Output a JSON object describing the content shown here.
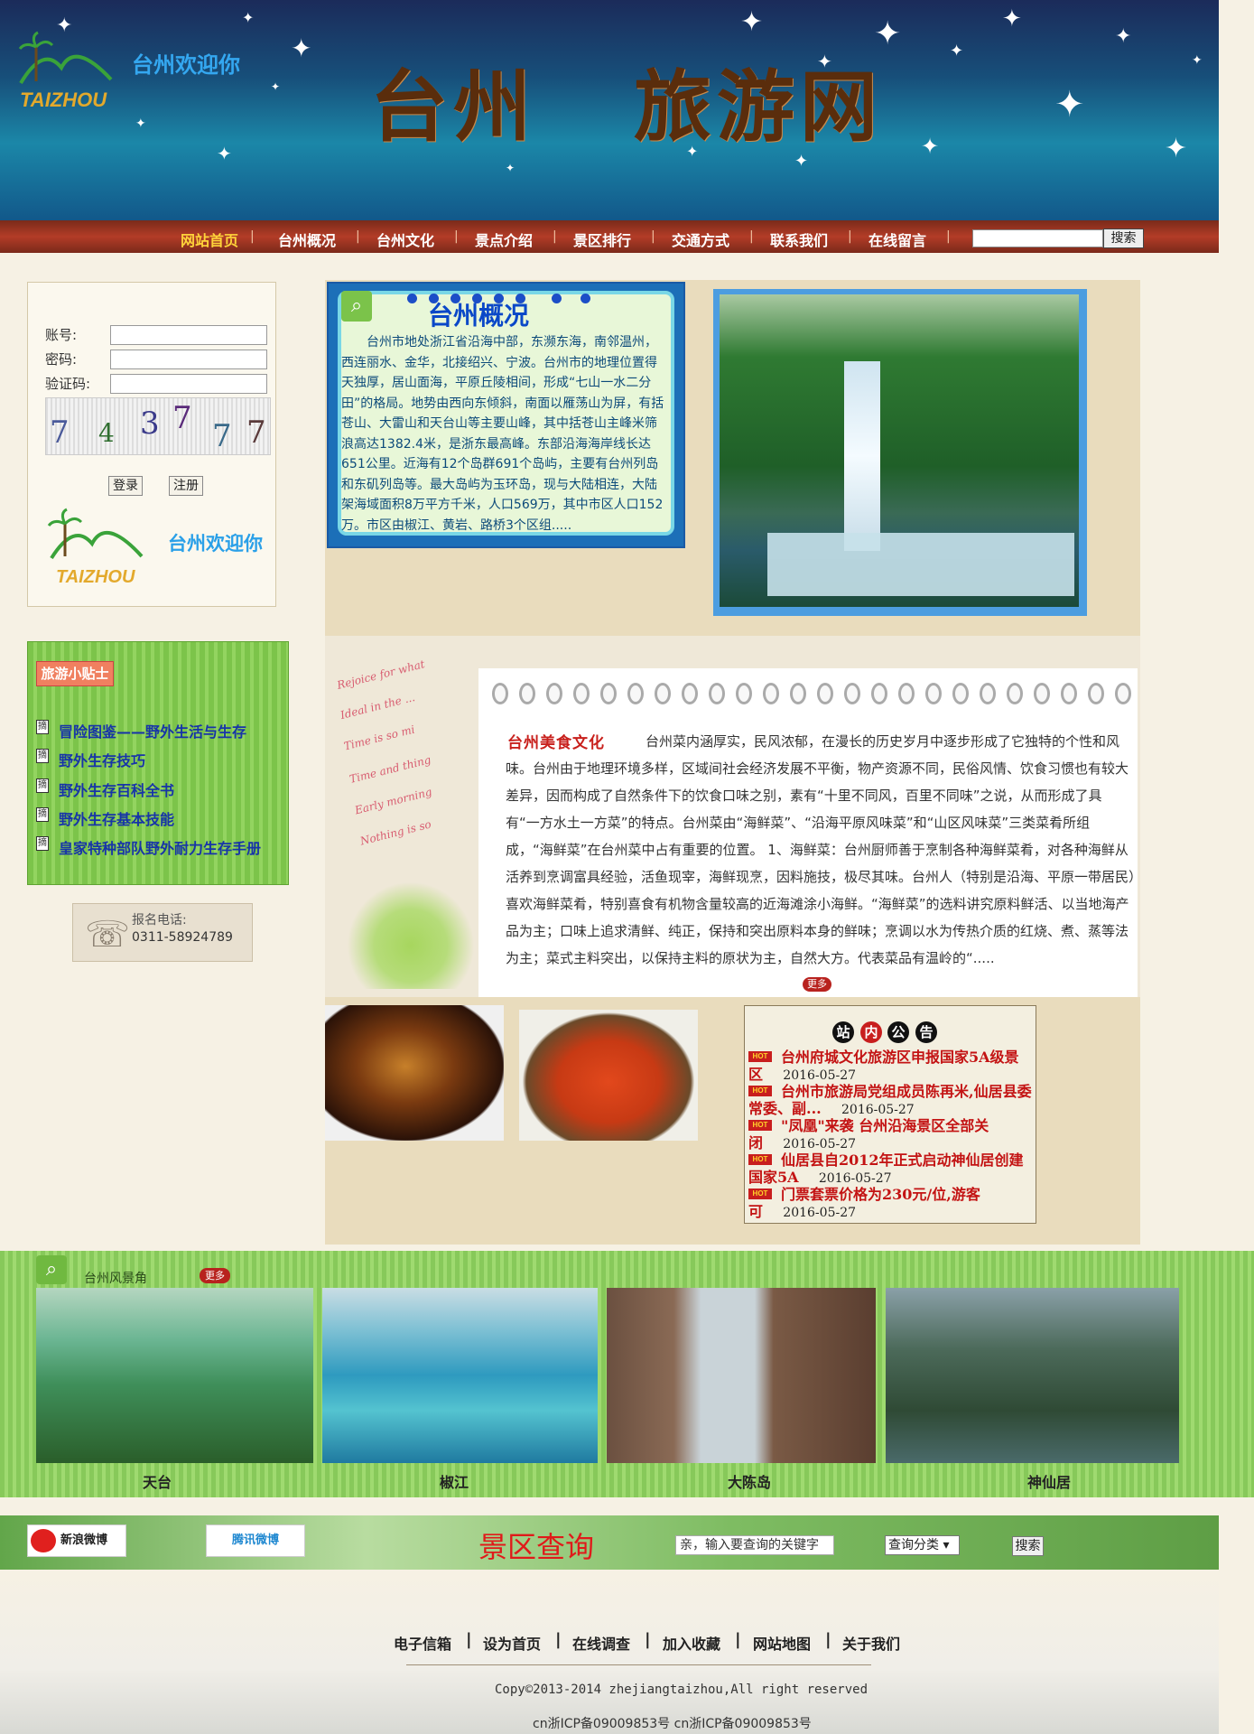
{
  "header": {
    "logo_text": "TAIZHOU",
    "welcome": "台州欢迎你",
    "site_title": "台州   旅游网"
  },
  "nav": {
    "items": [
      "网站首页",
      "台州概况",
      "台州文化",
      "景点介绍",
      "景区排行",
      "交通方式",
      "联系我们",
      "在线留言"
    ],
    "active_color": "#ffd43a",
    "search_button": "搜索"
  },
  "login": {
    "account_label": "账号:",
    "password_label": "密码:",
    "captcha_label": "验证码:",
    "captcha_chars": [
      "7",
      "4",
      "3",
      "7",
      "7",
      "7"
    ],
    "login_button": "登录",
    "register_button": "注册",
    "welcome": "台州欢迎你",
    "logo_text": "TAIZHOU"
  },
  "tips": {
    "title": "旅游小贴士",
    "icon_text": "摘",
    "items": [
      "冒险图鉴——野外生活与生存",
      "野外生存技巧",
      "野外生存百科全书",
      "野外生存基本技能",
      "皇家特种部队野外耐力生存手册"
    ]
  },
  "contact": {
    "label": "报名电话:",
    "phone": "0311-58924789"
  },
  "overview": {
    "title": "台州概况",
    "text": "台州市地处浙江省沿海中部，东濒东海，南邻温州，西连丽水、金华，北接绍兴、宁波。台州市的地理位置得天独厚，居山面海，平原丘陵相间，形成“七山一水二分田”的格局。地势由西向东倾斜，南面以雁荡山为屏，有括苍山、大雷山和天台山等主要山峰，其中括苍山主峰米筛浪高达1382.4米，是浙东最高峰。东部沿海海岸线长达651公里。近海有12个岛群691个岛屿，主要有台州列岛和东矶列岛等。最大岛屿为玉环岛，现与大陆相连，大陆架海域面积8万平方千米，人口569万，其中市区人口152万。市区由椒江、黄岩、路桥3个区组....."
  },
  "food": {
    "heading": "台州美食文化",
    "text": "台州菜内涵厚实，民风浓郁，在漫长的历史岁月中逐步形成了它独特的个性和风味。台州由于地理环境多样，区域间社会经济发展不平衡，物产资源不同，民俗风情、饮食习惯也有较大差异，因而构成了自然条件下的饮食口味之别，素有“十里不同风，百里不同味”之说，从而形成了具有“一方水土一方菜”的特点。台州菜由“海鲜菜”、“沿海平原风味菜”和“山区风味菜”三类菜肴所组成，“海鲜菜”在台州菜中占有重要的位置。 1、海鲜菜：台州厨师善于烹制各种海鲜菜肴，对各种海鲜从活养到烹调富具经验，活鱼现宰，海鲜现烹，因料施技，极尽其味。台州人（特别是沿海、平原一带居民）喜欢海鲜菜肴，特别喜食有机物含量较高的近海滩涂小海鲜。“海鲜菜”的选料讲究原料鲜活、以当地海产品为主；口味上追求清鲜、纯正，保持和突出原料本身的鲜味；烹调以水为传热介质的红烧、煮、蒸等法为主；菜式主料突出，以保持主料的原状为主，自然大方。代表菜品有温岭的“.....",
    "more": "更多",
    "script_lines": [
      "Rejoice for what",
      "Ideal in the ...",
      "Time is so mi",
      "Time and thing",
      "Early morning",
      "Nothing is so"
    ]
  },
  "notices": {
    "heading": [
      "站",
      "内",
      "公",
      "告"
    ],
    "hot_label": "HOT",
    "items": [
      {
        "title": "台州府城文化旅游区申报国家5A级景区",
        "date": "2016-05-27"
      },
      {
        "title": "台州市旅游局党组成员陈再米,仙居县委常委、副...",
        "date": "2016-05-27"
      },
      {
        "title": "\"凤凰\"来袭 台州沿海景区全部关闭",
        "date": "2016-05-27"
      },
      {
        "title": "仙居县自2012年正式启动神仙居创建国家5A",
        "date": "2016-05-27"
      },
      {
        "title": "门票套票价格为230元/位,游客可",
        "date": "2016-05-27"
      }
    ]
  },
  "scenery": {
    "title": "台州风景角",
    "more": "更多",
    "items": [
      "天台",
      "椒江",
      "大陈岛",
      "神仙居"
    ]
  },
  "query": {
    "weibo": "新浪微博",
    "weibo_sub": "weibo.com",
    "tqq": "腾讯微博",
    "title": "景区查询",
    "input_value": "亲，输入要查询的关键字",
    "select_value": "查询分类",
    "search_button": "搜索"
  },
  "footer": {
    "links": [
      "电子信箱",
      "设为首页",
      "在线调查",
      "加入收藏",
      "网站地图",
      "关于我们"
    ],
    "copyright": "Copy©2013-2014 zhejiangtaizhou,All right reserved",
    "icp": "cn浙ICP备09009853号 cn浙ICP备09009853号"
  }
}
